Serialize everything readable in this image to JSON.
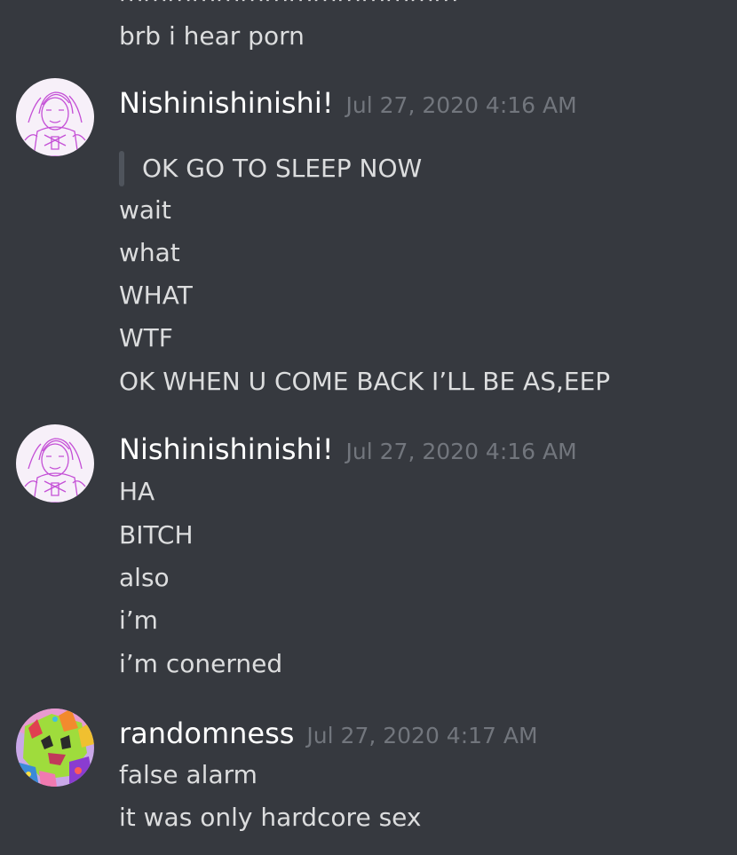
{
  "messages": {
    "m0": {
      "partial_line": "mmmmmmmmmmmmmm",
      "lines": [
        "brb i hear porn"
      ]
    },
    "m1": {
      "username": "Nishinishinishi!",
      "timestamp": "Jul 27, 2020 4:16 AM",
      "avatar_icon": "pink-sketch-avatar-icon",
      "quote": "OK GO TO SLEEP NOW",
      "lines": [
        "wait",
        "what",
        "WHAT",
        "WTF",
        "OK WHEN U COME BACK I’LL BE AS,EEP"
      ]
    },
    "m2": {
      "username": "Nishinishinishi!",
      "timestamp": "Jul 27, 2020 4:16 AM",
      "avatar_icon": "pink-sketch-avatar-icon",
      "lines": [
        "HA",
        "BITCH",
        "also",
        "i’m",
        "i’m conerned"
      ]
    },
    "m3": {
      "username": "randomness",
      "timestamp": "Jul 27, 2020 4:17 AM",
      "avatar_icon": "colorful-creature-avatar-icon",
      "lines": [
        "false alarm",
        "it was only hardcore sex"
      ]
    }
  },
  "colors": {
    "background": "#36393f",
    "text": "#dcddde",
    "username": "#ffffff",
    "timestamp": "#72767d",
    "quote_bar": "#4f545c"
  }
}
